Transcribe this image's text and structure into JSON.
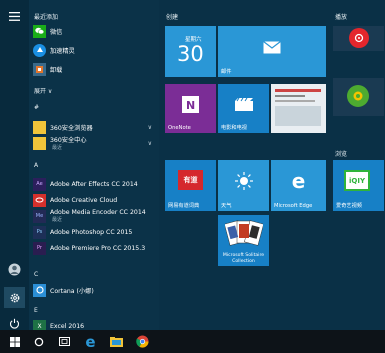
{
  "app_list": {
    "recent_header": "最近添加",
    "recent_items": [
      {
        "label": "微信",
        "icon": "wechat-icon",
        "color": "#1aad19"
      },
      {
        "label": "加速精灵",
        "icon": "accelerator-icon",
        "color": "#1a8fe3"
      },
      {
        "label": "卸载",
        "icon": "uninstall-icon",
        "color": "#e4762c"
      }
    ],
    "expand_label": "展开 ∨",
    "group_hash": "#",
    "hash_items": [
      {
        "label": "360安全浏览器",
        "icon": "folder-icon",
        "color": "#f0c43a"
      },
      {
        "label": "360安全中心",
        "sub": "最近",
        "icon": "folder-icon",
        "color": "#f0c43a"
      }
    ],
    "group_a": "A",
    "a_items": [
      {
        "label": "Adobe After Effects CC 2014",
        "icon": "ae-icon",
        "color": "#2b1f5c"
      },
      {
        "label": "Adobe Creative Cloud",
        "icon": "creative-cloud-icon",
        "color": "#d3302c"
      },
      {
        "label": "Adobe Media Encoder CC 2014",
        "sub": "最近",
        "icon": "media-encoder-icon",
        "color": "#222a55"
      },
      {
        "label": "Adobe Photoshop CC 2015",
        "icon": "photoshop-icon",
        "color": "#1d2f57"
      },
      {
        "label": "Adobe Premiere Pro CC 2015.3",
        "icon": "premiere-icon",
        "color": "#2a1d50"
      }
    ],
    "group_c": "C",
    "c_items": [
      {
        "label": "Cortana (小娜)",
        "icon": "cortana-icon",
        "color": "#2b8fd6"
      }
    ],
    "group_e": "E",
    "e_items": [
      {
        "label": "Excel 2016",
        "icon": "excel-icon",
        "color": "#1e7145"
      }
    ]
  },
  "tiles": {
    "create_header": "创建",
    "play_header": "播放",
    "browse_header": "浏览",
    "calendar": {
      "day_label": "星期六",
      "date": "30"
    },
    "mail_label": "邮件",
    "onenote_label": "OneNote",
    "movies_label": "电影和电视",
    "netease_label": "网易有道词典",
    "weather_label": "天气",
    "edge_label": "Microsoft Edge",
    "iqiyi_label": "爱奇艺视频",
    "solitaire_label": "Microsoft Solitaire Collection",
    "colors": {
      "accent": "#2a97d6",
      "tile_dark": "#1780c6",
      "onenote": "#7b2d96",
      "netease": "#d5282d",
      "play_red": "#e4262c",
      "play_green": "#4dab30",
      "iqiyi": "#2fb43b"
    }
  },
  "taskbar": {
    "icons": [
      "windows-icon",
      "search-icon",
      "task-view-icon",
      "edge-icon",
      "explorer-icon",
      "chrome-icon"
    ]
  }
}
